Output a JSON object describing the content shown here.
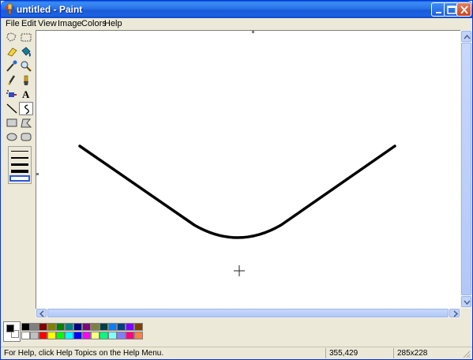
{
  "window": {
    "title": "untitled - Paint"
  },
  "menu": [
    "File",
    "Edit",
    "View",
    "Image",
    "Colors",
    "Help"
  ],
  "tools": [
    {
      "name": "free-form-select-icon"
    },
    {
      "name": "select-icon"
    },
    {
      "name": "eraser-icon"
    },
    {
      "name": "fill-icon"
    },
    {
      "name": "pick-color-icon"
    },
    {
      "name": "magnifier-icon"
    },
    {
      "name": "pencil-icon"
    },
    {
      "name": "brush-icon"
    },
    {
      "name": "airbrush-icon"
    },
    {
      "name": "text-icon"
    },
    {
      "name": "line-icon"
    },
    {
      "name": "curve-icon"
    },
    {
      "name": "rectangle-icon"
    },
    {
      "name": "polygon-icon"
    },
    {
      "name": "ellipse-icon"
    },
    {
      "name": "rounded-rectangle-icon"
    }
  ],
  "active_tool": "curve-icon",
  "text_tool_label": "A",
  "palette": {
    "foreground": "#000000",
    "background": "#ffffff",
    "row1": [
      "#000000",
      "#808080",
      "#800000",
      "#808000",
      "#008000",
      "#008080",
      "#000080",
      "#800080",
      "#808040",
      "#004040",
      "#0080ff",
      "#004080",
      "#8000ff",
      "#804000"
    ],
    "row2": [
      "#ffffff",
      "#c0c0c0",
      "#ff0000",
      "#ffff00",
      "#00ff00",
      "#00ffff",
      "#0000ff",
      "#ff00ff",
      "#ffff80",
      "#00ff80",
      "#80ffff",
      "#8080ff",
      "#ff0080",
      "#ff8040"
    ]
  },
  "status": {
    "help": "For Help, click Help Topics on the Help Menu.",
    "coords": "355,429",
    "size": "285x228"
  }
}
